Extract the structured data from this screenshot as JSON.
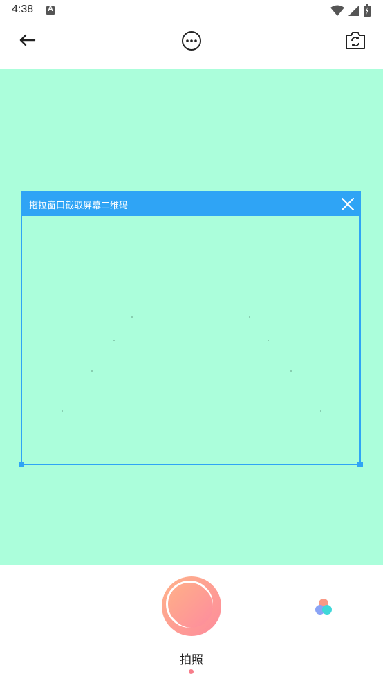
{
  "status_bar": {
    "time": "4:38"
  },
  "toolbar": {
    "back_icon": "arrow-left-icon",
    "more_icon": "more-horizontal-icon",
    "switch_icon": "camera-switch-icon"
  },
  "crop_window": {
    "title": "拖拉窗口截取屏幕二维码",
    "close_icon": "close-icon"
  },
  "bottom": {
    "mode_label": "拍照",
    "shutter_icon": "shutter-icon",
    "filter_icon": "color-filter-icon"
  },
  "colors": {
    "preview_bg": "#abfedb",
    "accent_blue": "#2fa4f5",
    "shutter_gradient_start": "#ffb38a",
    "shutter_gradient_end": "#fd8b9c",
    "mode_dot": "#f77d8a"
  }
}
